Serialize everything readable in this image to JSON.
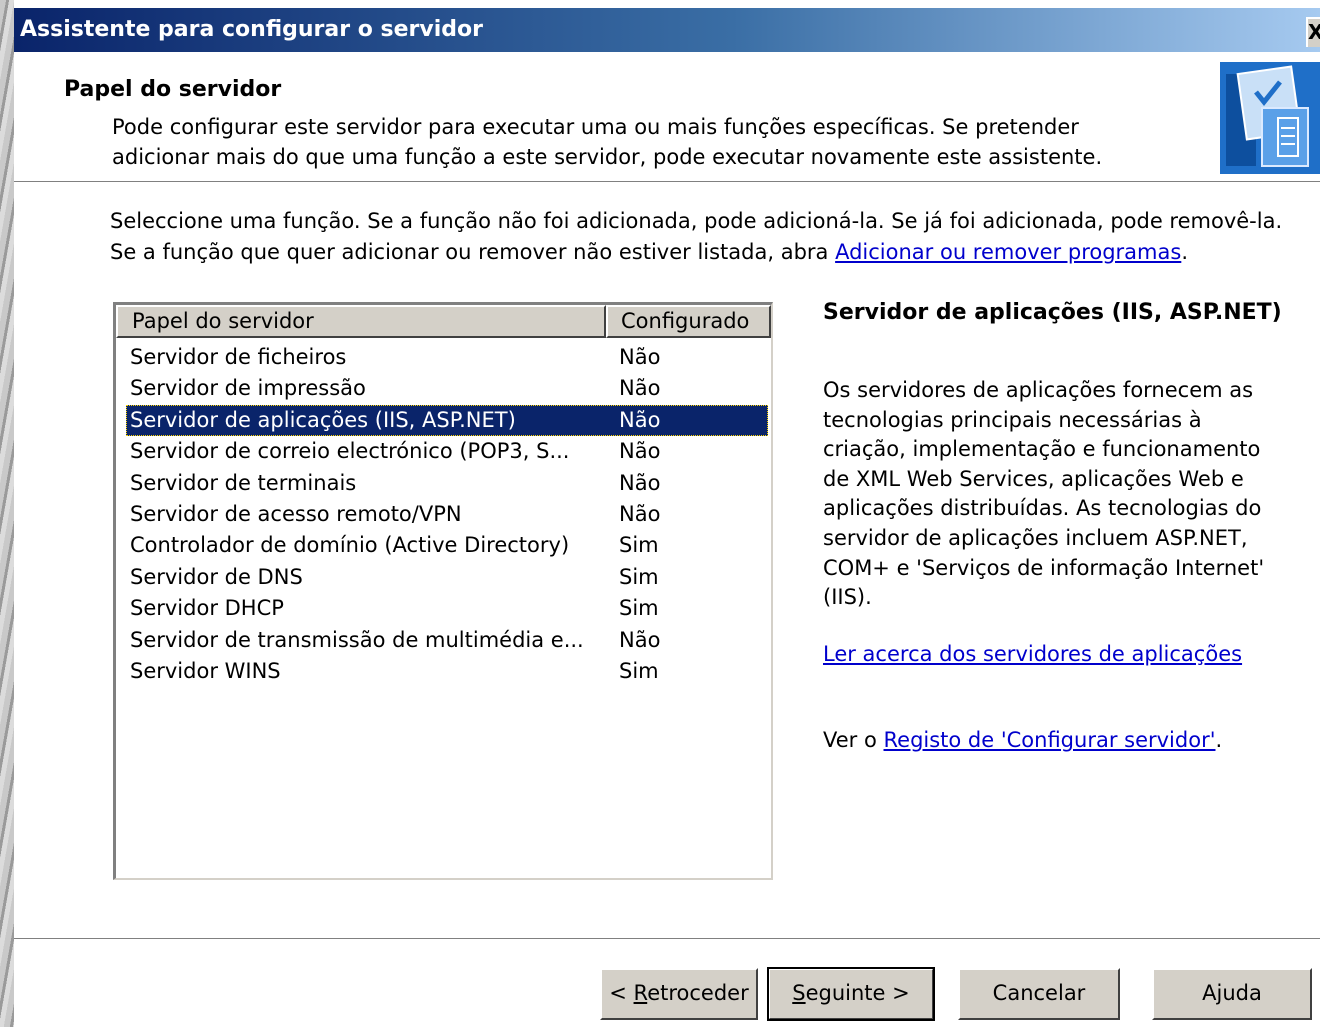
{
  "window": {
    "title": "Assistente para configurar o servidor",
    "close_glyph": "X"
  },
  "header": {
    "title": "Papel do servidor",
    "description": "Pode configurar este servidor para executar uma ou mais funções específicas. Se pretender adicionar mais do que uma função a este servidor, pode executar novamente este assistente.",
    "icon": "server-checklist-icon"
  },
  "intro": {
    "line1": "Seleccione uma função. Se a função não foi adicionada, pode adicioná-la. Se já foi adicionada, pode removê-la.",
    "line2_prefix": "Se a função que quer adicionar ou remover não estiver listada, abra ",
    "link": "Adicionar ou remover programas",
    "line2_suffix": "."
  },
  "roles": {
    "columns": [
      "Papel do servidor",
      "Configurado"
    ],
    "selected_index": 2,
    "rows": [
      {
        "role": "Servidor de ficheiros",
        "configured": "Não"
      },
      {
        "role": "Servidor de impressão",
        "configured": "Não"
      },
      {
        "role": "Servidor de aplicações (IIS, ASP.NET)",
        "configured": "Não"
      },
      {
        "role": "Servidor de correio electrónico (POP3, S...",
        "configured": "Não"
      },
      {
        "role": "Servidor de terminais",
        "configured": "Não"
      },
      {
        "role": "Servidor de acesso remoto/VPN",
        "configured": "Não"
      },
      {
        "role": "Controlador de domínio (Active Directory)",
        "configured": "Sim"
      },
      {
        "role": "Servidor de DNS",
        "configured": "Sim"
      },
      {
        "role": "Servidor DHCP",
        "configured": "Sim"
      },
      {
        "role": "Servidor de transmissão de multimédia e...",
        "configured": "Não"
      },
      {
        "role": "Servidor WINS",
        "configured": "Sim"
      }
    ]
  },
  "detail": {
    "title": "Servidor de aplicações (IIS, ASP.NET)",
    "body": "Os servidores de aplicações fornecem as tecnologias principais necessárias à criação, implementação e funcionamento de XML Web Services, aplicações Web e aplicações distribuídas. As tecnologias do servidor de aplicações incluem ASP.NET, COM+ e 'Serviços de informação Internet' (IIS).",
    "read_more_link": "Ler acerca dos servidores de aplicações",
    "log_prefix": "Ver o ",
    "log_link": "Registo de 'Configurar servidor'",
    "log_suffix": "."
  },
  "buttons": {
    "back_prefix": "< ",
    "back_key": "R",
    "back_rest": "etroceder",
    "next_key": "S",
    "next_rest": "eguinte >",
    "cancel": "Cancelar",
    "help": "Ajuda"
  }
}
